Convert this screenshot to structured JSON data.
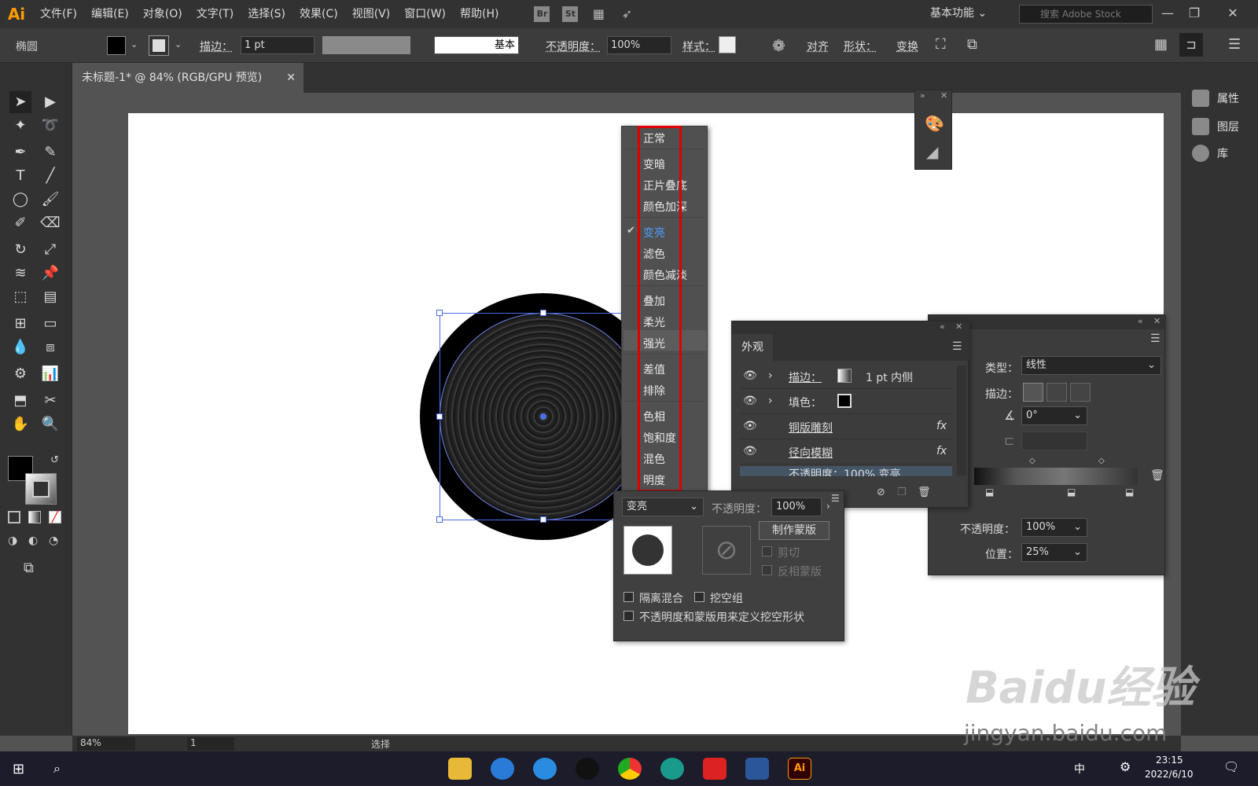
{
  "app": {
    "logo": "Ai",
    "menus": [
      "文件(F)",
      "编辑(E)",
      "对象(O)",
      "文字(T)",
      "选择(S)",
      "效果(C)",
      "视图(V)",
      "窗口(W)",
      "帮助(H)"
    ],
    "br": "Br",
    "st": "St",
    "workspace": "基本功能",
    "stock_placeholder": "搜索 Adobe Stock"
  },
  "control": {
    "object": "椭圆",
    "stroke_label": "描边：",
    "stroke_value": "1 pt",
    "profile": "基本",
    "opacity_label": "不透明度：",
    "opacity_value": "100%",
    "style_label": "样式：",
    "align": "对齐",
    "shape": "形状：",
    "transform": "变换"
  },
  "document": {
    "tab": "未标题-1* @ 84% (RGB/GPU 预览)",
    "zoom": "84%",
    "page": "1",
    "status": "选择"
  },
  "dock": {
    "properties": "属性",
    "layers": "图层",
    "libraries": "库"
  },
  "blend_menu": {
    "items": [
      "正常",
      "变暗",
      "正片叠底",
      "颜色加深",
      "变亮",
      "滤色",
      "颜色减淡",
      "叠加",
      "柔光",
      "强光",
      "差值",
      "排除",
      "色相",
      "饱和度",
      "混色",
      "明度"
    ],
    "checked": "变亮",
    "accent": "#4d9eff",
    "highlight": "#e00000"
  },
  "appearance": {
    "title": "外观",
    "rows": [
      {
        "label": "描边：",
        "value": "1 pt  内侧"
      },
      {
        "label": "填色：",
        "value": ""
      },
      {
        "label": "铜版雕刻",
        "value": "fx"
      },
      {
        "label": "径向模糊",
        "value": "fx"
      },
      {
        "label": "不透明度：100% 变亮",
        "value": ""
      }
    ]
  },
  "transparency": {
    "mode": "变亮",
    "opacity_label": "不透明度：",
    "opacity_value": "100%",
    "make_mask": "制作蒙版",
    "clip": "剪切",
    "invert": "反相蒙版",
    "isolate": "隔离混合",
    "knockout": "挖空组",
    "define": "不透明度和蒙版用来定义挖空形状"
  },
  "gradient": {
    "type_label": "类型：",
    "type_value": "线性",
    "stroke_label": "描边：",
    "angle": "0°",
    "opacity_label": "不透明度：",
    "opacity_value": "100%",
    "position_label": "位置：",
    "position_value": "25%"
  },
  "taskbar": {
    "time": "23:15",
    "date": "2022/6/10",
    "ime": "中"
  },
  "watermark": {
    "text": "Baidu经验",
    "sub": "jingyan.baidu.com"
  }
}
